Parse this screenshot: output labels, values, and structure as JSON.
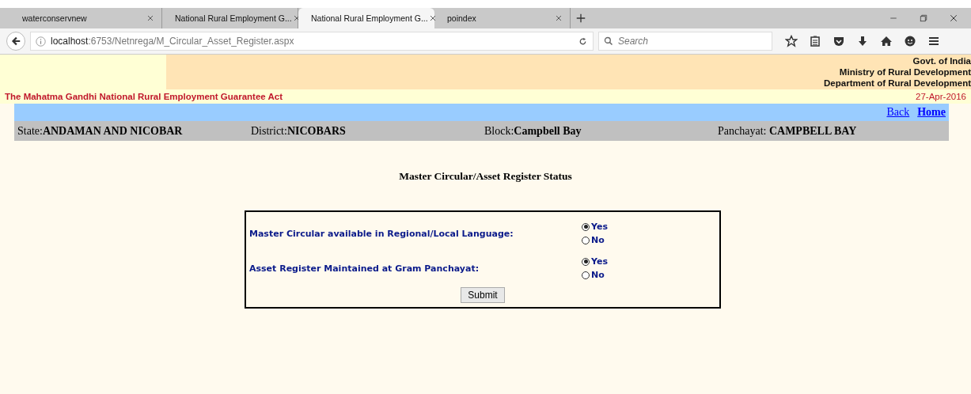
{
  "browser": {
    "tabs": [
      {
        "label": "waterconservnew",
        "selected": false
      },
      {
        "label": "National Rural Employment G...",
        "selected": false
      },
      {
        "label": "National Rural Employment G...",
        "selected": true
      },
      {
        "label": "poindex",
        "selected": false
      }
    ],
    "url_host": "localhost",
    "url_path": ":6753/Netnrega/M_Circular_Asset_Register.aspx",
    "search": {
      "placeholder": "Search"
    }
  },
  "header": {
    "gov_lines": [
      "Govt. of India",
      "Ministry of Rural Development",
      "Department of Rural Development"
    ],
    "act_title": "The Mahatma Gandhi National Rural Employment Guarantee Act",
    "date": "27-Apr-2016"
  },
  "nav_links": [
    "Back",
    "Home"
  ],
  "location": [
    {
      "label": "State:",
      "value": "ANDAMAN AND NICOBAR"
    },
    {
      "label": "District:",
      "value": "NICOBARS"
    },
    {
      "label": "Block:",
      "value": "Campbell Bay"
    },
    {
      "label": "Panchayat: ",
      "value": "CAMPBELL BAY"
    }
  ],
  "form": {
    "title": "Master Circular/Asset Register Status",
    "questions": [
      {
        "label": "Master Circular available in Regional/Local Language:",
        "options": [
          {
            "label": "Yes",
            "selected": true
          },
          {
            "label": "No",
            "selected": false
          }
        ]
      },
      {
        "label": "Asset Register Maintained at Gram Panchayat:",
        "options": [
          {
            "label": "Yes",
            "selected": true
          },
          {
            "label": "No",
            "selected": false
          }
        ]
      }
    ],
    "submit": "Submit"
  }
}
